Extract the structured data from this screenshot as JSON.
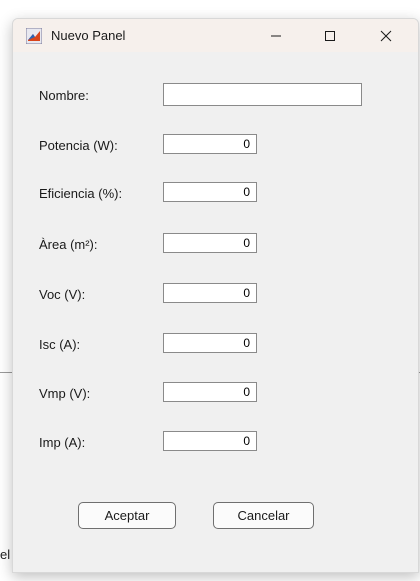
{
  "background": {
    "fragment_text": "el"
  },
  "window": {
    "title": "Nuevo Panel",
    "icon": "matlab-icon",
    "controls": {
      "minimize": "minimize-icon",
      "maximize": "maximize-icon",
      "close": "close-icon"
    }
  },
  "form": {
    "nombre": {
      "label": "Nombre:",
      "value": ""
    },
    "fields": [
      {
        "label": "Potencia (W):",
        "value": "0"
      },
      {
        "label": "Eficiencia (%):",
        "value": "0"
      },
      {
        "label": "Àrea (m²):",
        "value": "0"
      },
      {
        "label": "Voc (V):",
        "value": "0"
      },
      {
        "label": "Isc (A):",
        "value": "0"
      },
      {
        "label": "Vmp (V):",
        "value": "0"
      },
      {
        "label": "Imp (A):",
        "value": "0"
      }
    ]
  },
  "buttons": {
    "accept": "Aceptar",
    "cancel": "Cancelar"
  },
  "colors": {
    "dialog_bg": "#f0f0f0",
    "titlebar_bg": "#f6f0ec",
    "input_border": "#8a8a8a"
  }
}
